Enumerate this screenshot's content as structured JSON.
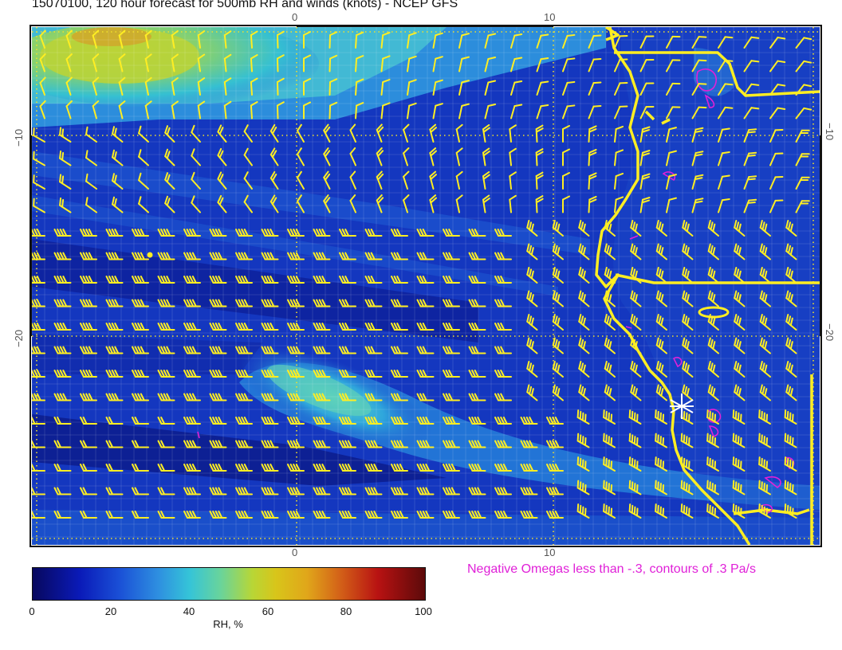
{
  "title": "15070100, 120 hour forecast for 500mb RH and winds (knots) - NCEP GFS",
  "axes": {
    "top_ticks": [
      "0",
      "10"
    ],
    "bottom_ticks": [
      "0",
      "10"
    ],
    "left_ticks": [
      "−10",
      "−20"
    ],
    "right_ticks": [
      "−10",
      "−20"
    ]
  },
  "map": {
    "field": "500mb RH",
    "overlay": "wind barbs (knots)",
    "contours": "negative omegas (magenta)",
    "coastline_color": "#ffee22",
    "barb_color": "#ffee22",
    "omega_color": "#e020d8",
    "marker": "white star near coast"
  },
  "colorbar": {
    "ticks": [
      "0",
      "20",
      "40",
      "60",
      "80",
      "100"
    ],
    "label": "RH, %"
  },
  "omega_note": "Negative Omegas less than -.3, contours of .3 Pa/s"
}
